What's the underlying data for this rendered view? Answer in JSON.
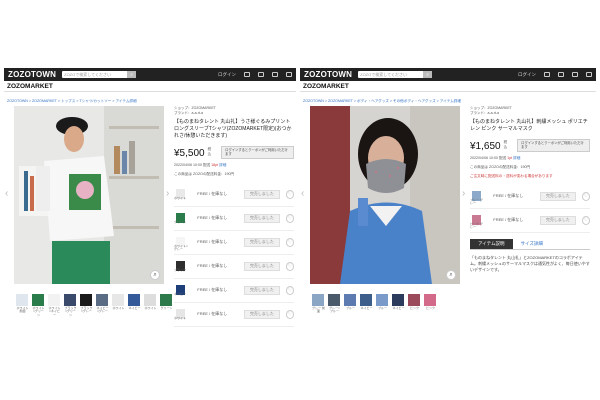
{
  "left": {
    "logo": "ZOZOTOWN",
    "search_placeholder": "ZOZOで検索してください",
    "login": "ログイン",
    "subbar": "ZOZOMARKET",
    "breadcrumb": "ZOZOTOWN > ZOZOMARKET > トップス > Tシャツ/カットソー > アイテム詳細",
    "shop": "ショップ：ZOZOMARKET",
    "brand": "ブランド：a-a-rt-a",
    "title": "【ものまねタレント 丸山礼】うさ様ぐるみプリント ロングスリーブTシャツ(ZOZOMARKET限定)(おつかれさ/休憩いただきます)",
    "price": "¥5,500",
    "tax": "税込",
    "coupon": "ログインするとクーポンがご利用いただけます",
    "pnote1": "2022/04/06 10:00 配送",
    "pnote1_pts": "18pt",
    "pnote1_link": "詳細",
    "pnote2": "この商品は ZOZOの配送料金：190円",
    "variants": [
      {
        "swatch": "#e9e9e9",
        "label": "ホワイト",
        "size": "FREE / 在庫なし",
        "cart": "完売しました"
      },
      {
        "swatch": "#2a7d4a",
        "label": "グリーン",
        "size": "FREE / 在庫なし",
        "cart": "完売しました"
      },
      {
        "swatch": "#f5f5f5",
        "label": "ホワイト×グレー",
        "size": "FREE / 在庫なし",
        "cart": "完売しました"
      },
      {
        "swatch": "#2e2e2e",
        "label": "ブラック",
        "size": "FREE / 在庫なし",
        "cart": "完売しました"
      },
      {
        "swatch": "#1f3f7a",
        "label": "ネイビー",
        "size": "FREE / 在庫なし",
        "cart": "完売しました"
      },
      {
        "swatch": "#e6e6e6",
        "label": "ホワイト",
        "size": "FREE / 在庫なし",
        "cart": "完売しました"
      }
    ],
    "thumbs": [
      {
        "color": "#dfe6ee",
        "label": "ホワイト 前面"
      },
      {
        "color": "#2a7d4a",
        "label": "ホワイト×グリーン"
      },
      {
        "color": "#f2f2f2",
        "label": "ホワイト×ネイビー"
      },
      {
        "color": "#3a4a6a",
        "label": "ブラック×グリーン"
      },
      {
        "color": "#1b1b1b",
        "label": "ブラック×グレー"
      },
      {
        "color": "#5a6b84",
        "label": "ネイビー×グレー"
      },
      {
        "color": "#e7e7e7",
        "label": "ホワイト"
      },
      {
        "color": "#355a9a",
        "label": "ネイビー"
      },
      {
        "color": "#ddd",
        "label": "ホワイト"
      },
      {
        "color": "#2f7a4a",
        "label": "グリーン"
      }
    ]
  },
  "right": {
    "logo": "ZOZOTOWN",
    "search_placeholder": "ZOZOで検索してください",
    "login": "ログイン",
    "subbar": "ZOZOMARKET",
    "breadcrumb": "ZOZOTOWN > ZOZOMARKET > ボディ・ヘアグッズ > その他ボディ・ヘアグッズ > アイテム詳細",
    "shop": "ショップ：ZOZOMARKET",
    "brand": "ブランド：a-a-rt-a",
    "title": "【ものまねタレント 丸山礼】刺繍メッシュ ポリエチレン ピンク サーマルマスク",
    "price": "¥1,650",
    "tax": "税込",
    "coupon": "ログインするとクーポンがご利用いただけます",
    "pnote1": "2022/04/06 10:00 配送",
    "pnote1_pts": "1pt",
    "pnote1_link": "詳細",
    "pnote2": "この商品は ZOZOの配送料金：190円",
    "pnote3": "ご注文時に配送料の・送料が変わる場合があります",
    "variants": [
      {
        "swatch": "#8da9c9",
        "label": "ブルー グレー",
        "size": "FREE / 在庫なし",
        "cart": "完売しました"
      },
      {
        "swatch": "#c97a92",
        "label": "ピンク グレー",
        "size": "FREE / 在庫なし",
        "cart": "完売しました"
      }
    ],
    "tabs": [
      "アイテム説明",
      "サイズ詳細"
    ],
    "desc": "「ものまねタレント 丸山礼」とZOZOMARKETのコラボアイテム。刺繍メッシュのサーマルマスクは通気性がよく、毎日使いやすいデザインです。",
    "thumbs": [
      {
        "color": "#8aa6c4",
        "label": "グレー 前面"
      },
      {
        "color": "#4a5a6a",
        "label": "グレー×ブルー"
      },
      {
        "color": "#5d7bb0",
        "label": "ブルー"
      },
      {
        "color": "#3d5d8a",
        "label": "ネイビー"
      },
      {
        "color": "#7a9ac9",
        "label": "ブルー"
      },
      {
        "color": "#2c3c5c",
        "label": "ネイビー"
      },
      {
        "color": "#9a4a5a",
        "label": "ピンク"
      },
      {
        "color": "#d46a8a",
        "label": "ピンク"
      }
    ]
  }
}
